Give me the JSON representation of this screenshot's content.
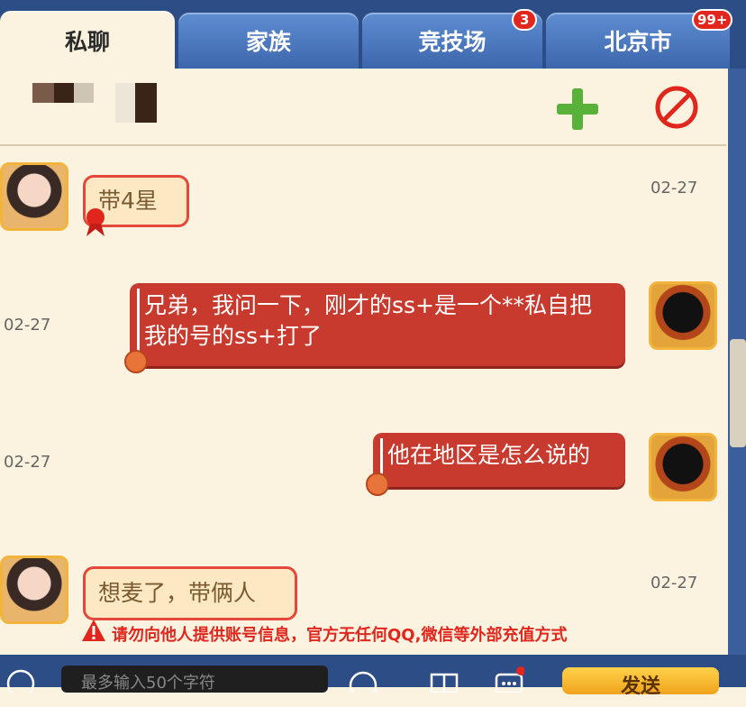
{
  "tabs": [
    {
      "label": "私聊",
      "active": true
    },
    {
      "label": "家族",
      "active": false
    },
    {
      "label": "竞技场",
      "active": false,
      "badge": "3"
    },
    {
      "label": "北京市",
      "active": false,
      "badge": "99+"
    }
  ],
  "header": {
    "add_icon": "plus-icon",
    "block_icon": "prohibit-icon"
  },
  "messages": [
    {
      "side": "left",
      "text": "带4星",
      "time": "02-27"
    },
    {
      "side": "right",
      "text": "兄弟，我问一下，刚才的ss+是一个**私自把我的号的ss+打了",
      "time": "02-27"
    },
    {
      "side": "right",
      "text": "他在地区是怎么说的",
      "time": "02-27"
    },
    {
      "side": "left",
      "text": "想麦了，带俩人",
      "time": "02-27"
    }
  ],
  "warning": "请勿向他人提供账号信息，官方无任何QQ,微信等外部充值方式",
  "input": {
    "placeholder": "最多输入50个字符"
  },
  "send_label": "发送",
  "colors": {
    "tab_bar": "#2d4d86",
    "panel": "#fbf3df",
    "bubble_right": "#c83a2e",
    "bubble_left": "#fde8c4",
    "warning": "#e0261d",
    "add": "#58b23a"
  }
}
